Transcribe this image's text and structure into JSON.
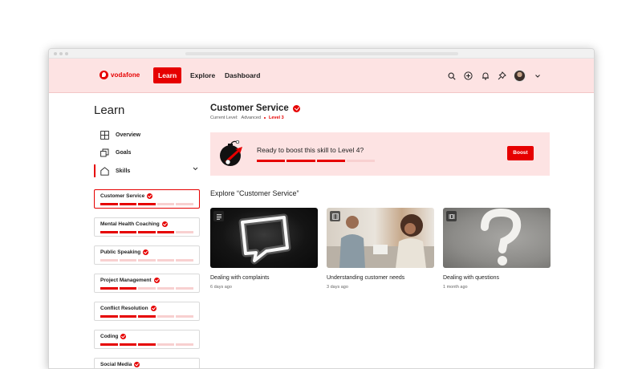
{
  "brand": {
    "name": "vodafone",
    "accent": "#e60000",
    "tint": "#fde3e3"
  },
  "topnav": {
    "tabs": [
      {
        "label": "Learn",
        "active": true
      },
      {
        "label": "Explore",
        "active": false
      },
      {
        "label": "Dashboard",
        "active": false
      }
    ],
    "icons": [
      "search-icon",
      "add-circle-icon",
      "bell-icon",
      "pin-icon",
      "avatar",
      "chevron-down-icon"
    ]
  },
  "sidebar": {
    "title": "Learn",
    "menu": [
      {
        "label": "Overview",
        "icon": "grid-icon"
      },
      {
        "label": "Goals",
        "icon": "goals-icon"
      },
      {
        "label": "Skills",
        "icon": "pentagon-icon",
        "active": true,
        "expanded": true
      }
    ],
    "skills": [
      {
        "name": "Customer Service",
        "progress": 3,
        "of": 5,
        "selected": true
      },
      {
        "name": "Mental Health Coaching",
        "progress": 4,
        "of": 5
      },
      {
        "name": "Public Speaking",
        "progress": 0,
        "of": 5
      },
      {
        "name": "Project Management",
        "progress": 2,
        "of": 5
      },
      {
        "name": "Conflict Resolution",
        "progress": 3,
        "of": 5
      },
      {
        "name": "Coding",
        "progress": 3,
        "of": 5
      },
      {
        "name": "Social Media",
        "progress": 0,
        "of": 5
      }
    ]
  },
  "main": {
    "title": "Customer Service",
    "level_label": "Current Level:",
    "level_value": "Advanced",
    "level_tag": "Level 3",
    "boost": {
      "text": "Ready to boost this skill to Level 4?",
      "button": "Boost",
      "progress": 3,
      "of": 4
    },
    "explore_title": "Explore “Customer Service”",
    "cards": [
      {
        "title": "Dealing with complaints",
        "age": "6 days ago",
        "type": "article-icon"
      },
      {
        "title": "Understanding customer needs",
        "age": "3 days ago",
        "type": "video-icon"
      },
      {
        "title": "Dealing with questions",
        "age": "1 month ago",
        "type": "ebook-icon"
      }
    ]
  }
}
